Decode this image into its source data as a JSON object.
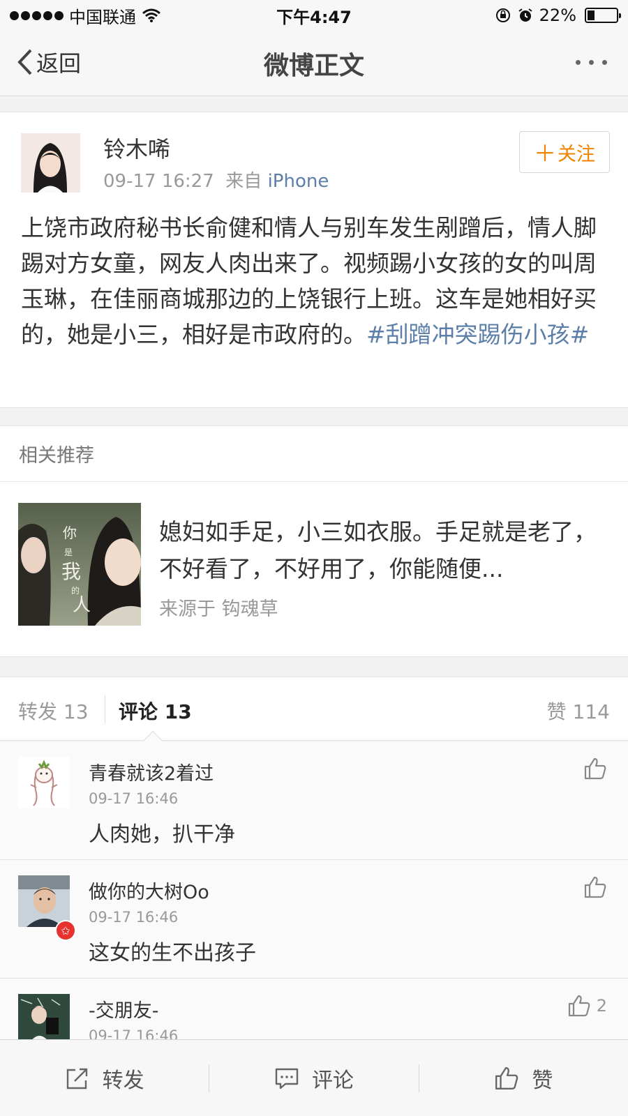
{
  "status_bar": {
    "carrier": "中国联通",
    "time": "下午4:47",
    "battery_text": "22%",
    "battery_level": 0.22
  },
  "nav": {
    "back_label": "返回",
    "title": "微博正文"
  },
  "post": {
    "author": "铃木唏",
    "time": "09-17 16:27",
    "source_prefix": "来自",
    "source": "iPhone",
    "follow_label": "关注",
    "text": "上饶市政府秘书长俞健和情人与别车发生剐蹭后，情人脚踢对方女童，网友人肉出来了。视频踢小女孩的女的叫周玉琳，在佳丽商城那边的上饶银行上班。这车是她相好买的，她是小三，相好是市政府的。",
    "topic": "#刮蹭冲突踢伤小孩#"
  },
  "related": {
    "header": "相关推荐",
    "text": "媳妇如手足，小三如衣服。手足就是老了，不好看了，不好用了，你能随便...",
    "source": "来源于 钩魂草",
    "thumb_overlay": "你是我的人"
  },
  "tabs": {
    "repost": "转发 13",
    "comment": "评论 13",
    "like": "赞 114"
  },
  "comments": [
    {
      "name": "青春就该2着过",
      "time": "09-17 16:46",
      "text": "人肉她，扒干净",
      "likes": ""
    },
    {
      "name": "做你的大树Oo",
      "time": "09-17 16:46",
      "text": "这女的生不出孩子",
      "likes": ""
    },
    {
      "name": "-交朋友-",
      "time": "09-17 16:46",
      "text": "",
      "likes": "2"
    }
  ],
  "bottom_bar": {
    "repost": "转发",
    "comment": "评论",
    "like": "赞"
  },
  "colors": {
    "link": "#5b7fa8",
    "follow": "#f08300",
    "badge": "#e8322f"
  }
}
